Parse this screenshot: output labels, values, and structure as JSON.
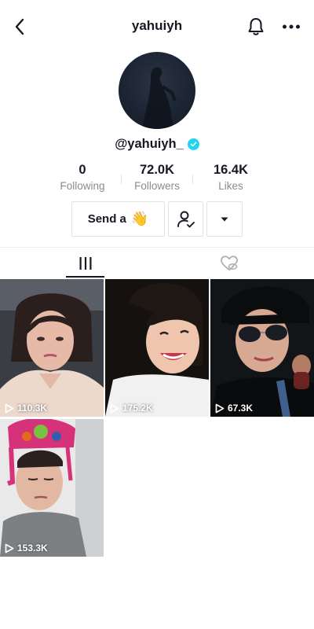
{
  "header": {
    "title": "yahuiyh",
    "back_icon": "chevron-left-icon",
    "bell_icon": "bell-icon",
    "more_icon": "more-horizontal-icon"
  },
  "profile": {
    "handle": "@yahuiyh_",
    "verified": true,
    "verified_color": "#20d5ec",
    "stats": [
      {
        "value": "0",
        "label": "Following"
      },
      {
        "value": "72.0K",
        "label": "Followers"
      },
      {
        "value": "16.4K",
        "label": "Likes"
      }
    ]
  },
  "actions": {
    "send_label": "Send a",
    "send_emoji": "👋",
    "friend_icon": "person-check-icon",
    "dropdown_icon": "caret-down-icon"
  },
  "tabs": [
    {
      "name": "videos",
      "icon": "grid-bars-icon",
      "active": true
    },
    {
      "name": "liked",
      "icon": "heart-hidden-icon",
      "active": false
    }
  ],
  "videos": [
    {
      "views": "110.3K"
    },
    {
      "views": "175.2K"
    },
    {
      "views": "67.3K"
    },
    {
      "views": "153.3K"
    }
  ]
}
